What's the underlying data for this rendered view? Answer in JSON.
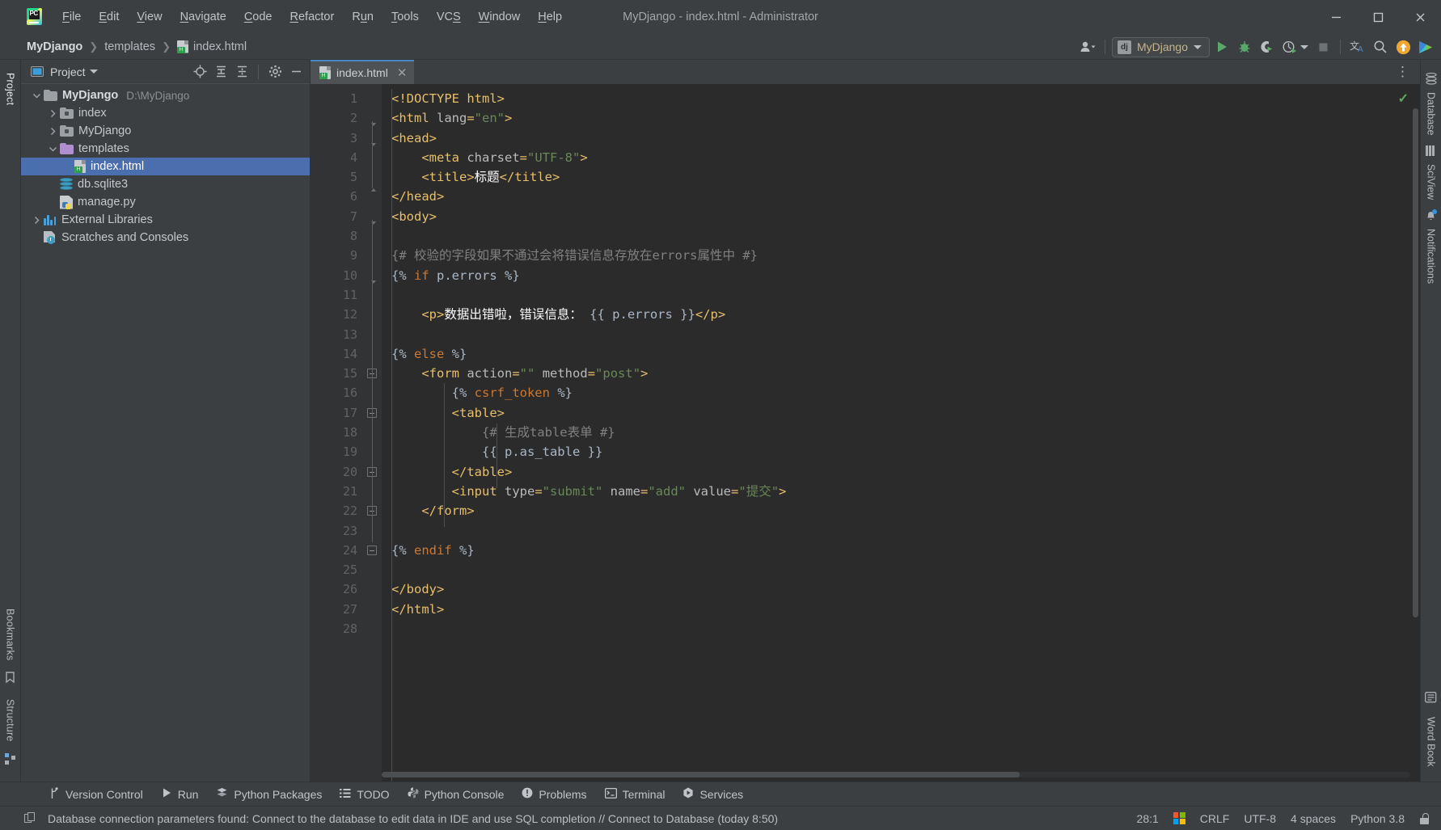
{
  "window": {
    "title": "MyDjango - index.html - Administrator",
    "logo_icon": "pycharm-logo-icon",
    "minimize_label": "—",
    "maximize_label": "□",
    "close_label": "✕"
  },
  "menubar": {
    "items": [
      {
        "label": "File",
        "mnemonic": "F"
      },
      {
        "label": "Edit",
        "mnemonic": "E"
      },
      {
        "label": "View",
        "mnemonic": "V"
      },
      {
        "label": "Navigate",
        "mnemonic": "N"
      },
      {
        "label": "Code",
        "mnemonic": "C"
      },
      {
        "label": "Refactor",
        "mnemonic": "R"
      },
      {
        "label": "Run",
        "mnemonic": "u"
      },
      {
        "label": "Tools",
        "mnemonic": "T"
      },
      {
        "label": "VCS",
        "mnemonic": "S"
      },
      {
        "label": "Window",
        "mnemonic": "W"
      },
      {
        "label": "Help",
        "mnemonic": "H"
      }
    ]
  },
  "breadcrumb": {
    "items": [
      "MyDjango",
      "templates",
      "index.html"
    ],
    "separator": "❯",
    "file_icon": "html-file-icon"
  },
  "toolbar": {
    "account_icon": "user-account-icon",
    "run_config": {
      "label": "MyDjango",
      "icon": "django-icon"
    },
    "run_icon": "run-play-icon",
    "debug_icon": "debug-bug-icon",
    "coverage_icon": "run-with-coverage-icon",
    "profile_icon": "profiler-icon",
    "stop_icon": "stop-square-icon",
    "translate_icon": "translate-icon",
    "search_icon": "search-icon",
    "update_icon": "update-available-icon",
    "ide_feature_icon": "ide-feature-trainer-icon"
  },
  "left_strip": {
    "tabs": [
      "Project",
      "Bookmarks",
      "Structure"
    ]
  },
  "project_panel": {
    "header": {
      "title": "Project",
      "window_icon": "project-window-icon",
      "dropdown_icon": "chevron-down-icon",
      "locate_icon": "select-opened-file-icon",
      "expand_icon": "expand-all-icon",
      "collapse_icon": "collapse-all-icon",
      "settings_icon": "gear-icon",
      "hide_icon": "hide-panel-icon"
    },
    "tree": [
      {
        "label": "MyDjango",
        "path": "D:\\MyDjango",
        "icon": "folder-icon",
        "indent": 0,
        "arrow": "expanded",
        "bold": true,
        "selected": false
      },
      {
        "label": "index",
        "path": "",
        "icon": "module-folder-icon",
        "indent": 1,
        "arrow": "collapsed",
        "bold": false,
        "selected": false
      },
      {
        "label": "MyDjango",
        "path": "",
        "icon": "module-folder-icon",
        "indent": 1,
        "arrow": "collapsed",
        "bold": false,
        "selected": false
      },
      {
        "label": "templates",
        "path": "",
        "icon": "templates-folder-icon",
        "indent": 1,
        "arrow": "expanded",
        "bold": false,
        "selected": false
      },
      {
        "label": "index.html",
        "path": "",
        "icon": "html-file-icon",
        "indent": 2,
        "arrow": "none",
        "bold": false,
        "selected": true
      },
      {
        "label": "db.sqlite3",
        "path": "",
        "icon": "database-file-icon",
        "indent": 1,
        "arrow": "none",
        "bold": false,
        "selected": false
      },
      {
        "label": "manage.py",
        "path": "",
        "icon": "python-file-icon",
        "indent": 1,
        "arrow": "none",
        "bold": false,
        "selected": false
      },
      {
        "label": "External Libraries",
        "path": "",
        "icon": "libraries-icon",
        "indent": 0,
        "arrow": "collapsed",
        "bold": false,
        "selected": false
      },
      {
        "label": "Scratches and Consoles",
        "path": "",
        "icon": "scratches-icon",
        "indent": 0,
        "arrow": "none",
        "bold": false,
        "selected": false
      }
    ]
  },
  "editor": {
    "tab": {
      "label": "index.html",
      "icon": "html-file-icon",
      "close_icon": "close-icon"
    },
    "options_icon": "more-options-icon",
    "inspection_status_icon": "inspections-ok-check-icon",
    "total_lines": 28,
    "lines": [
      {
        "n": 1,
        "tokens": [
          {
            "t": "<!DOCTYPE html>",
            "c": "tok-tag"
          }
        ],
        "indent": 0
      },
      {
        "n": 2,
        "tokens": [
          {
            "t": "<html ",
            "c": "tok-tag"
          },
          {
            "t": "lang",
            "c": "tok-attr"
          },
          {
            "t": "=",
            "c": "tok-tag"
          },
          {
            "t": "\"en\"",
            "c": "tok-val"
          },
          {
            "t": ">",
            "c": "tok-tag"
          }
        ],
        "indent": 0
      },
      {
        "n": 3,
        "tokens": [
          {
            "t": "<head>",
            "c": "tok-tag"
          }
        ],
        "indent": 0
      },
      {
        "n": 4,
        "tokens": [
          {
            "t": "    <meta ",
            "c": "tok-tag"
          },
          {
            "t": "charset",
            "c": "tok-attr"
          },
          {
            "t": "=",
            "c": "tok-tag"
          },
          {
            "t": "\"UTF-8\"",
            "c": "tok-val"
          },
          {
            "t": ">",
            "c": "tok-tag"
          }
        ],
        "indent": 4
      },
      {
        "n": 5,
        "tokens": [
          {
            "t": "    <title>",
            "c": "tok-tag"
          },
          {
            "t": "标题",
            "c": "tok-text"
          },
          {
            "t": "</title>",
            "c": "tok-tag"
          }
        ],
        "indent": 4
      },
      {
        "n": 6,
        "tokens": [
          {
            "t": "</head>",
            "c": "tok-tag"
          }
        ],
        "indent": 0
      },
      {
        "n": 7,
        "tokens": [
          {
            "t": "<body>",
            "c": "tok-tag"
          }
        ],
        "indent": 0
      },
      {
        "n": 8,
        "tokens": [],
        "indent": 0
      },
      {
        "n": 9,
        "tokens": [
          {
            "t": "{# 校验的字段如果不通过会将错误信息存放在errors属性中 #}",
            "c": "tok-cmt"
          }
        ],
        "indent": 0
      },
      {
        "n": 10,
        "tokens": [
          {
            "t": "{% ",
            "c": "tok-brace"
          },
          {
            "t": "if",
            "c": "tok-kw"
          },
          {
            "t": " p.errors %}",
            "c": "tok-brace"
          }
        ],
        "indent": 0
      },
      {
        "n": 11,
        "tokens": [],
        "indent": 0
      },
      {
        "n": 12,
        "tokens": [
          {
            "t": "    <p>",
            "c": "tok-tag"
          },
          {
            "t": "数据出错啦，错误信息： ",
            "c": "tok-text"
          },
          {
            "t": "{{ p.errors }}",
            "c": "tok-brace"
          },
          {
            "t": "</p>",
            "c": "tok-tag"
          }
        ],
        "indent": 4
      },
      {
        "n": 13,
        "tokens": [],
        "indent": 0
      },
      {
        "n": 14,
        "tokens": [
          {
            "t": "{% ",
            "c": "tok-brace"
          },
          {
            "t": "else",
            "c": "tok-kw"
          },
          {
            "t": " %}",
            "c": "tok-brace"
          }
        ],
        "indent": 0
      },
      {
        "n": 15,
        "tokens": [
          {
            "t": "    <form ",
            "c": "tok-tag"
          },
          {
            "t": "action",
            "c": "tok-attr"
          },
          {
            "t": "=",
            "c": "tok-tag"
          },
          {
            "t": "\"\"",
            "c": "tok-val"
          },
          {
            "t": " ",
            "c": "tok-tag"
          },
          {
            "t": "method",
            "c": "tok-attr"
          },
          {
            "t": "=",
            "c": "tok-tag"
          },
          {
            "t": "\"post\"",
            "c": "tok-val"
          },
          {
            "t": ">",
            "c": "tok-tag"
          }
        ],
        "indent": 4
      },
      {
        "n": 16,
        "tokens": [
          {
            "t": "        {% ",
            "c": "tok-brace"
          },
          {
            "t": "csrf_token",
            "c": "tok-kw"
          },
          {
            "t": " %}",
            "c": "tok-brace"
          }
        ],
        "indent": 8
      },
      {
        "n": 17,
        "tokens": [
          {
            "t": "        <table>",
            "c": "tok-tag"
          }
        ],
        "indent": 8
      },
      {
        "n": 18,
        "tokens": [
          {
            "t": "            {# 生成table表单 #}",
            "c": "tok-cmt"
          }
        ],
        "indent": 12
      },
      {
        "n": 19,
        "tokens": [
          {
            "t": "            {{ p.as_table }}",
            "c": "tok-brace"
          }
        ],
        "indent": 12
      },
      {
        "n": 20,
        "tokens": [
          {
            "t": "        </table>",
            "c": "tok-tag"
          }
        ],
        "indent": 8
      },
      {
        "n": 21,
        "tokens": [
          {
            "t": "        <input ",
            "c": "tok-tag"
          },
          {
            "t": "type",
            "c": "tok-attr"
          },
          {
            "t": "=",
            "c": "tok-tag"
          },
          {
            "t": "\"submit\"",
            "c": "tok-val"
          },
          {
            "t": " ",
            "c": "tok-tag"
          },
          {
            "t": "name",
            "c": "tok-attr"
          },
          {
            "t": "=",
            "c": "tok-tag"
          },
          {
            "t": "\"add\"",
            "c": "tok-val"
          },
          {
            "t": " ",
            "c": "tok-tag"
          },
          {
            "t": "value",
            "c": "tok-attr"
          },
          {
            "t": "=",
            "c": "tok-tag"
          },
          {
            "t": "\"提交\"",
            "c": "tok-val"
          },
          {
            "t": ">",
            "c": "tok-tag"
          }
        ],
        "indent": 8
      },
      {
        "n": 22,
        "tokens": [
          {
            "t": "    </form>",
            "c": "tok-tag"
          }
        ],
        "indent": 4
      },
      {
        "n": 23,
        "tokens": [],
        "indent": 0
      },
      {
        "n": 24,
        "tokens": [
          {
            "t": "{% ",
            "c": "tok-brace"
          },
          {
            "t": "endif",
            "c": "tok-kw"
          },
          {
            "t": " %}",
            "c": "tok-brace"
          }
        ],
        "indent": 0
      },
      {
        "n": 25,
        "tokens": [],
        "indent": 0
      },
      {
        "n": 26,
        "tokens": [
          {
            "t": "</body>",
            "c": "tok-tag"
          }
        ],
        "indent": 0
      },
      {
        "n": 27,
        "tokens": [
          {
            "t": "</html>",
            "c": "tok-tag"
          }
        ],
        "indent": 0
      },
      {
        "n": 28,
        "tokens": [],
        "indent": 0
      }
    ]
  },
  "right_strip": {
    "tabs": [
      {
        "label": "Database",
        "icon": "database-icon"
      },
      {
        "label": "SciView",
        "icon": "sciview-grid-icon"
      },
      {
        "label": "Notifications",
        "icon": "notifications-bell-icon",
        "badge": true
      }
    ],
    "bottom_icon": "word-book-icon",
    "bottom_label": "Word Book"
  },
  "tool_window_bar": {
    "items": [
      {
        "label": "Version Control",
        "icon": "branch-icon"
      },
      {
        "label": "Run",
        "icon": "run-play-icon"
      },
      {
        "label": "Python Packages",
        "icon": "packages-icon"
      },
      {
        "label": "TODO",
        "icon": "todo-list-icon"
      },
      {
        "label": "Python Console",
        "icon": "python-icon"
      },
      {
        "label": "Problems",
        "icon": "problems-warning-icon"
      },
      {
        "label": "Terminal",
        "icon": "terminal-icon"
      },
      {
        "label": "Services",
        "icon": "services-play-icon"
      }
    ]
  },
  "status_bar": {
    "left_icon": "event-log-icon",
    "message": "Database connection parameters found: Connect to the database to edit data in IDE and use SQL completion // Connect to Database (today 8:50)",
    "caret_position": "28:1",
    "os_icon": "windows-logo-icon",
    "line_separator": "CRLF",
    "encoding": "UTF-8",
    "indent": "4 spaces",
    "interpreter": "Python 3.8",
    "lock_icon": "unlocked-icon"
  },
  "colors": {
    "panel_bg": "#3c3f41",
    "editor_bg": "#2b2b2b",
    "gutter_bg": "#313335",
    "selection_blue": "#4b6eaf",
    "tab_active_border": "#4a88c7",
    "tag_orange": "#e8bf6a",
    "string_green": "#6a8759",
    "keyword_orange": "#cc7832",
    "comment_gray": "#808080",
    "text_default": "#a9b7c6",
    "run_green": "#59a869",
    "update_orange": "#f5a623"
  }
}
